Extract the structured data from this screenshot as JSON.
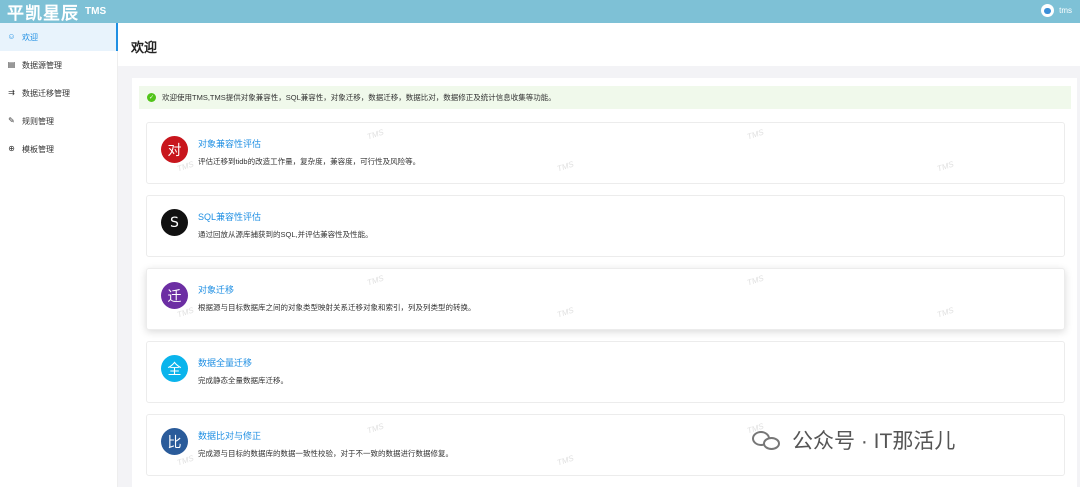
{
  "header": {
    "brand": "平凯星辰",
    "brand_sub": "TMS",
    "user": "tms"
  },
  "sidebar": {
    "items": [
      {
        "label": "欢迎",
        "icon": "smile-icon",
        "active": true
      },
      {
        "label": "数据源管理",
        "icon": "document-icon",
        "active": false
      },
      {
        "label": "数据迁移管理",
        "icon": "migrate-icon",
        "active": false
      },
      {
        "label": "规则管理",
        "icon": "edit-icon",
        "active": false
      },
      {
        "label": "模板管理",
        "icon": "globe-icon",
        "active": false
      }
    ]
  },
  "page": {
    "title": "欢迎"
  },
  "alert": {
    "text": "欢迎使用TMS,TMS提供对象兼容性，SQL兼容性，对象迁移，数据迁移，数据比对，数据修正及统计信息收集等功能。"
  },
  "cards": [
    {
      "badge": "对",
      "color": "#c8161d",
      "title": "对象兼容性评估",
      "desc": "评估迁移到tidb的改造工作量，复杂度，兼容度，可行性及风险等。"
    },
    {
      "badge": "S",
      "color": "#111111",
      "title": "SQL兼容性评估",
      "desc": "通过回放从源库捕获到的SQL,并评估兼容性及性能。"
    },
    {
      "badge": "迁",
      "color": "#6c2ea3",
      "title": "对象迁移",
      "desc": "根据源与目标数据库之间的对象类型映射关系迁移对象和索引，列及列类型的转换。"
    },
    {
      "badge": "全",
      "color": "#0ab4ec",
      "title": "数据全量迁移",
      "desc": "完成静态全量数据库迁移。"
    },
    {
      "badge": "比",
      "color": "#2a5b9a",
      "title": "数据比对与修正",
      "desc": "完成源与目标的数据库的数据一致性校验，对于不一致的数据进行数据修复。"
    }
  ],
  "watermark": "TMS",
  "footer": {
    "text": "公众号 · IT那活儿"
  }
}
